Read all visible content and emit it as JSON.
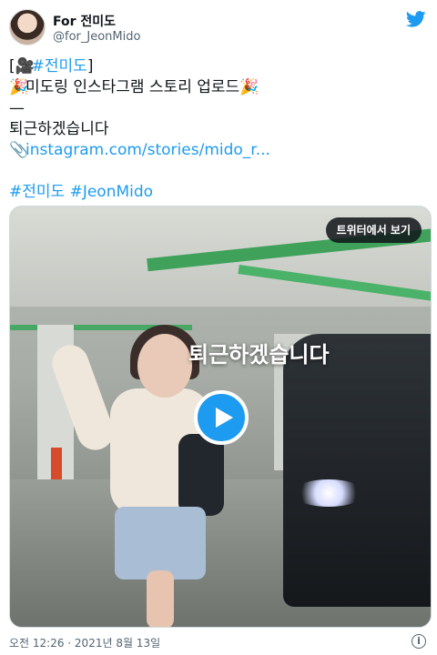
{
  "author": {
    "name": "For 전미도",
    "handle": "@for_JeonMido"
  },
  "tweet": {
    "line1_bracket_open": "[",
    "line1_hashtag": "#전미도",
    "line1_bracket_close": "]",
    "line2_text": "미도링 인스타그램 스토리 업로드",
    "line3_text": "—",
    "line4_text": "퇴근하겠습니다",
    "link_text": "instagram.com/stories/mido_r...",
    "hashtag_1": "#전미도",
    "hashtag_2": "#JeonMido"
  },
  "media": {
    "caption": "퇴근하겠습니다",
    "view_on_twitter": "트위터에서 보기"
  },
  "footer": {
    "timestamp": "오전 12:26 · 2021년 8월 13일",
    "info": "i"
  },
  "icons": {
    "brand": "twitter-bird-icon",
    "camera": "movie-camera-icon",
    "party": "party-popper-icon",
    "clip": "paperclip-icon",
    "play": "play-icon",
    "info": "info-icon"
  },
  "colors": {
    "accent": "#1d9bf0",
    "text": "#0f1419",
    "muted": "#536471"
  }
}
